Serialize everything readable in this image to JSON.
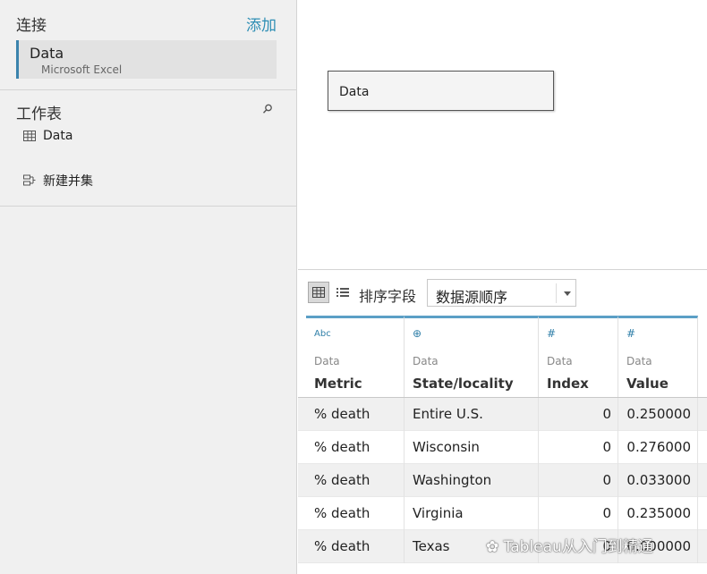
{
  "connections": {
    "header": "连接",
    "add_label": "添加",
    "items": [
      {
        "name": "Data",
        "type": "Microsoft Excel"
      }
    ]
  },
  "worksheets": {
    "header": "工作表",
    "items": [
      {
        "label": "Data"
      }
    ],
    "new_union_label": "新建并集"
  },
  "canvas": {
    "table_label": "Data"
  },
  "toolbar": {
    "sort_label": "排序字段",
    "sort_value": "数据源顺序"
  },
  "grid": {
    "columns": [
      {
        "type": "Abc",
        "icon": "string-type-icon",
        "source": "Data",
        "name": "Metric"
      },
      {
        "type": "⊕",
        "icon": "geo-type-icon",
        "source": "Data",
        "name": "State/locality"
      },
      {
        "type": "#",
        "icon": "number-type-icon",
        "source": "Data",
        "name": "Index"
      },
      {
        "type": "#",
        "icon": "number-type-icon",
        "source": "Data",
        "name": "Value"
      }
    ],
    "rows": [
      [
        "% death",
        "Entire U.S.",
        "0",
        "0.250000"
      ],
      [
        "% death",
        "Wisconsin",
        "0",
        "0.276000"
      ],
      [
        "% death",
        "Washington",
        "0",
        "0.033000"
      ],
      [
        "% death",
        "Virginia",
        "0",
        "0.235000"
      ],
      [
        "% death",
        "Texas",
        "0",
        "0.000000"
      ]
    ]
  },
  "watermark": "Tableau从入门到精通",
  "colors": {
    "accent": "#2f8fb5",
    "selection_bar": "#3b83ad",
    "header_bar": "#5b9fc6"
  }
}
